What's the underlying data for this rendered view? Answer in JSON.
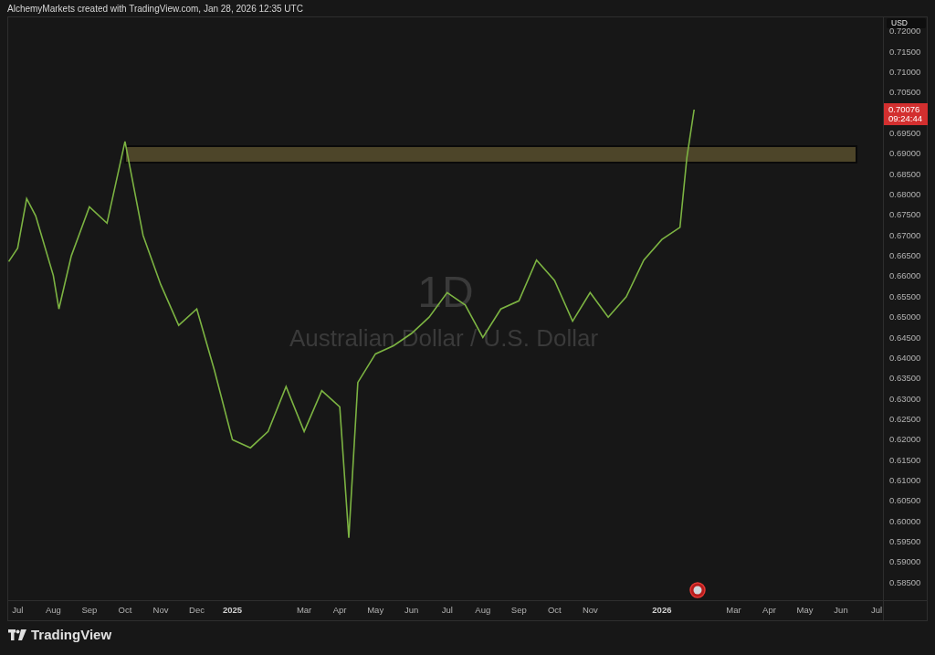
{
  "header": {
    "text": "AlchemyMarkets created with TradingView.com, Jan 28, 2026 12:35 UTC"
  },
  "chart": {
    "currency_button": "USD",
    "watermark_interval": "1D",
    "watermark_symbol": "Australian Dollar / U.S. Dollar",
    "last_price": "0.70076",
    "countdown": "09:24:44",
    "chart_data": {
      "type": "line",
      "x": [
        2024.479,
        2024.5,
        2024.521,
        2024.542,
        2024.583,
        2024.596,
        2024.625,
        2024.667,
        2024.708,
        2024.75,
        2024.792,
        2024.833,
        2024.875,
        2024.917,
        2024.958,
        2025.0,
        2025.042,
        2025.083,
        2025.125,
        2025.167,
        2025.208,
        2025.25,
        2025.271,
        2025.292,
        2025.333,
        2025.375,
        2025.417,
        2025.458,
        2025.5,
        2025.542,
        2025.583,
        2025.625,
        2025.667,
        2025.708,
        2025.75,
        2025.792,
        2025.833,
        2025.875,
        2025.917,
        2025.958,
        2026.0,
        2026.042,
        2026.058,
        2026.075
      ],
      "series": [
        {
          "color": "#7cb342",
          "values": [
            0.6636,
            0.6669,
            0.679,
            0.6748,
            0.6602,
            0.652,
            0.665,
            0.677,
            0.673,
            0.693,
            0.67,
            0.658,
            0.648,
            0.652,
            0.637,
            0.62,
            0.618,
            0.622,
            0.633,
            0.622,
            0.632,
            0.628,
            0.596,
            0.634,
            0.641,
            0.643,
            0.646,
            0.65,
            0.656,
            0.653,
            0.645,
            0.652,
            0.654,
            0.664,
            0.659,
            0.649,
            0.656,
            0.65,
            0.655,
            0.664,
            0.669,
            0.672,
            0.689,
            0.7008
          ]
        }
      ],
      "xlim": [
        2024.478,
        2026.621
      ],
      "ylim": [
        0.5807,
        0.7234
      ],
      "xticks": [
        {
          "value": 2024.5,
          "label": "Jul"
        },
        {
          "value": 2024.583,
          "label": "Aug"
        },
        {
          "value": 2024.667,
          "label": "Sep"
        },
        {
          "value": 2024.75,
          "label": "Oct"
        },
        {
          "value": 2024.833,
          "label": "Nov"
        },
        {
          "value": 2024.917,
          "label": "Dec"
        },
        {
          "value": 2025,
          "label": "2025"
        },
        {
          "value": 2025.167,
          "label": "Mar"
        },
        {
          "value": 2025.25,
          "label": "Apr"
        },
        {
          "value": 2025.333,
          "label": "May"
        },
        {
          "value": 2025.417,
          "label": "Jun"
        },
        {
          "value": 2025.5,
          "label": "Jul"
        },
        {
          "value": 2025.583,
          "label": "Aug"
        },
        {
          "value": 2025.667,
          "label": "Sep"
        },
        {
          "value": 2025.75,
          "label": "Oct"
        },
        {
          "value": 2025.833,
          "label": "Nov"
        },
        {
          "value": 2026,
          "label": "2026"
        },
        {
          "value": 2026.167,
          "label": "Mar"
        },
        {
          "value": 2026.25,
          "label": "Apr"
        },
        {
          "value": 2026.333,
          "label": "May"
        },
        {
          "value": 2026.417,
          "label": "Jun"
        },
        {
          "value": 2026.5,
          "label": "Jul"
        }
      ],
      "yticks": [
        {
          "value": 0.72,
          "label": "0.72000"
        },
        {
          "value": 0.715,
          "label": "0.71500"
        },
        {
          "value": 0.71,
          "label": "0.71000"
        },
        {
          "value": 0.705,
          "label": "0.70500"
        },
        {
          "value": 0.695,
          "label": "0.69500"
        },
        {
          "value": 0.69,
          "label": "0.69000"
        },
        {
          "value": 0.685,
          "label": "0.68500"
        },
        {
          "value": 0.68,
          "label": "0.68000"
        },
        {
          "value": 0.675,
          "label": "0.67500"
        },
        {
          "value": 0.67,
          "label": "0.67000"
        },
        {
          "value": 0.665,
          "label": "0.66500"
        },
        {
          "value": 0.66,
          "label": "0.66000"
        },
        {
          "value": 0.655,
          "label": "0.65500"
        },
        {
          "value": 0.65,
          "label": "0.65000"
        },
        {
          "value": 0.645,
          "label": "0.64500"
        },
        {
          "value": 0.64,
          "label": "0.64000"
        },
        {
          "value": 0.635,
          "label": "0.63500"
        },
        {
          "value": 0.63,
          "label": "0.63000"
        },
        {
          "value": 0.625,
          "label": "0.62500"
        },
        {
          "value": 0.62,
          "label": "0.62000"
        },
        {
          "value": 0.615,
          "label": "0.61500"
        },
        {
          "value": 0.61,
          "label": "0.61000"
        },
        {
          "value": 0.605,
          "label": "0.60500"
        },
        {
          "value": 0.6,
          "label": "0.60000"
        },
        {
          "value": 0.595,
          "label": "0.59500"
        },
        {
          "value": 0.59,
          "label": "0.59000"
        },
        {
          "value": 0.585,
          "label": "0.58500"
        }
      ]
    }
  },
  "footer": {
    "logo_text": "TradingView"
  }
}
